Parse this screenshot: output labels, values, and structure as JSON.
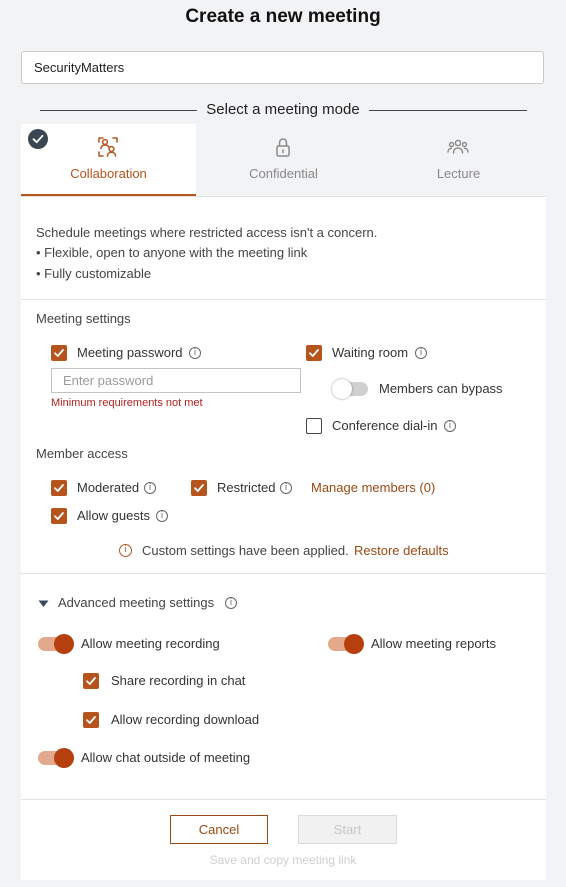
{
  "dialog": {
    "title": "Create a new meeting"
  },
  "meeting_name": {
    "value": "SecurityMatters"
  },
  "mode_header": "Select a meeting mode",
  "modes": [
    {
      "label": "Collaboration",
      "icon": "collaboration-icon",
      "selected": true
    },
    {
      "label": "Confidential",
      "icon": "lock-icon",
      "selected": false
    },
    {
      "label": "Lecture",
      "icon": "people-icon",
      "selected": false
    }
  ],
  "description": {
    "intro": "Schedule meetings where restricted access isn't a concern.",
    "bullets": [
      "• Flexible, open to anyone with the meeting link",
      "• Fully customizable"
    ]
  },
  "meeting_settings": {
    "header": "Meeting settings",
    "password_label": "Meeting password",
    "password_placeholder": "Enter password",
    "password_error": "Minimum requirements not met",
    "waiting_room_label": "Waiting room",
    "members_bypass_label": "Members can bypass",
    "dial_in_label": "Conference dial-in"
  },
  "member_access": {
    "header": "Member access",
    "moderated_label": "Moderated",
    "restricted_label": "Restricted",
    "manage_members_label": "Manage members (0)",
    "allow_guests_label": "Allow guests",
    "custom_notice": "Custom settings have been applied.",
    "restore_label": "Restore defaults"
  },
  "advanced": {
    "header": "Advanced meeting settings",
    "recording_label": "Allow meeting recording",
    "reports_label": "Allow meeting reports",
    "share_recording_label": "Share recording in chat",
    "allow_download_label": "Allow recording download",
    "chat_outside_label": "Allow chat outside of meeting"
  },
  "footer": {
    "cancel_label": "Cancel",
    "start_label": "Start",
    "save_copy_label": "Save and copy meeting link"
  },
  "colors": {
    "accent": "#b5541c",
    "link": "#9c4a13",
    "error": "#b22222",
    "badge": "#3a4652"
  }
}
